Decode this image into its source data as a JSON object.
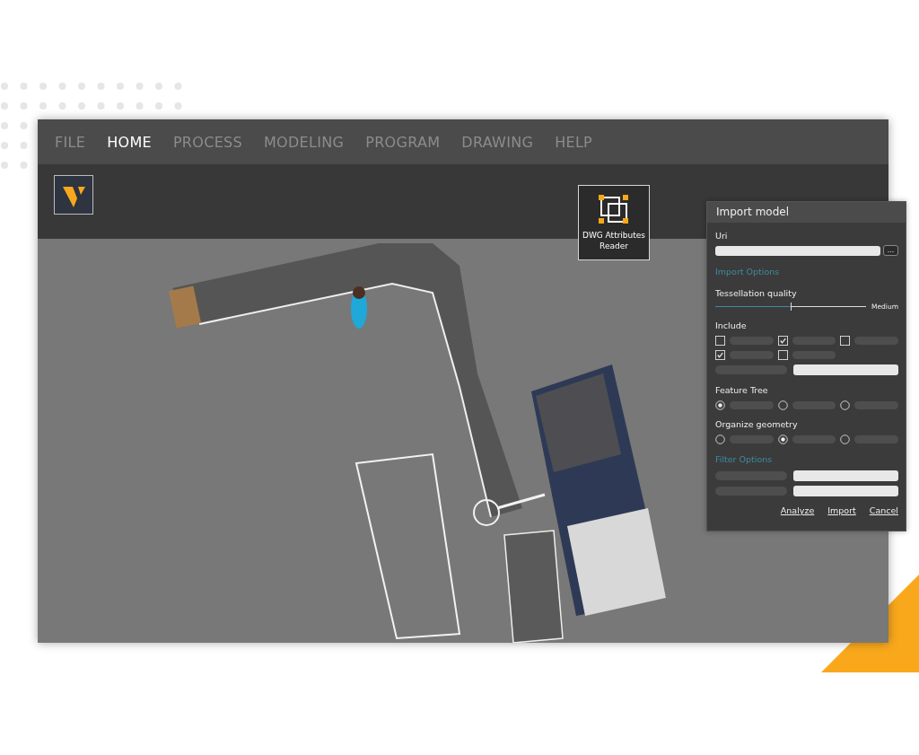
{
  "menu": [
    {
      "label": "FILE",
      "selected": false
    },
    {
      "label": "HOME",
      "selected": true
    },
    {
      "label": "PROCESS",
      "selected": false
    },
    {
      "label": "MODELING",
      "selected": false
    },
    {
      "label": "PROGRAM",
      "selected": false
    },
    {
      "label": "DRAWING",
      "selected": false
    },
    {
      "label": "HELP",
      "selected": false
    }
  ],
  "tool_button": {
    "label": "DWG Attributes Reader"
  },
  "dialog": {
    "title": "Import model",
    "uri_label": "Uri",
    "browse_button": "...",
    "import_options_heading": "Import Options",
    "tessellation": {
      "label": "Tessellation quality",
      "level": 0.5,
      "reading": "Medium"
    },
    "include": {
      "label": "Include",
      "checkboxes": [
        {
          "checked": false
        },
        {
          "checked": true
        },
        {
          "checked": false
        },
        {
          "checked": true
        },
        {
          "checked": false
        }
      ]
    },
    "feature_tree": {
      "label": "Feature Tree",
      "radios": [
        {
          "selected": true
        },
        {
          "selected": false
        },
        {
          "selected": false
        }
      ]
    },
    "organize_geometry": {
      "label": "Organize geometry",
      "radios": [
        {
          "selected": false
        },
        {
          "selected": true
        },
        {
          "selected": false
        }
      ]
    },
    "filter_options_heading": "Filter Options",
    "buttons": [
      "Analyze",
      "Import",
      "Cancel"
    ]
  }
}
